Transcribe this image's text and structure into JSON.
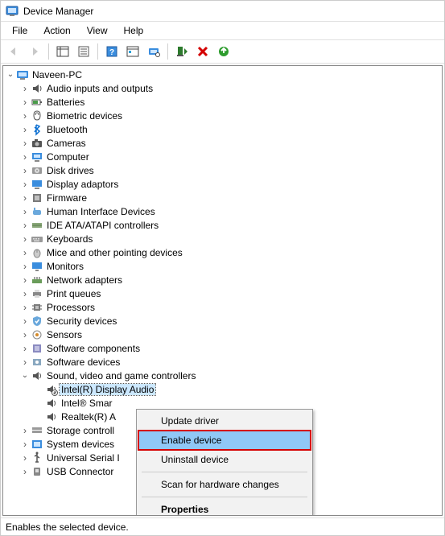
{
  "title": "Device Manager",
  "menu": {
    "file": "File",
    "action": "Action",
    "view": "View",
    "help": "Help"
  },
  "root": "Naveen-PC",
  "cats": [
    {
      "label": "Audio inputs and outputs",
      "icon": "speaker"
    },
    {
      "label": "Batteries",
      "icon": "battery"
    },
    {
      "label": "Biometric devices",
      "icon": "finger"
    },
    {
      "label": "Bluetooth",
      "icon": "bluetooth"
    },
    {
      "label": "Cameras",
      "icon": "camera"
    },
    {
      "label": "Computer",
      "icon": "computer"
    },
    {
      "label": "Disk drives",
      "icon": "disk"
    },
    {
      "label": "Display adaptors",
      "icon": "display"
    },
    {
      "label": "Firmware",
      "icon": "firmware"
    },
    {
      "label": "Human Interface Devices",
      "icon": "hid"
    },
    {
      "label": "IDE ATA/ATAPI controllers",
      "icon": "ide"
    },
    {
      "label": "Keyboards",
      "icon": "keyboard"
    },
    {
      "label": "Mice and other pointing devices",
      "icon": "mouse"
    },
    {
      "label": "Monitors",
      "icon": "monitor"
    },
    {
      "label": "Network adapters",
      "icon": "net"
    },
    {
      "label": "Print queues",
      "icon": "printer"
    },
    {
      "label": "Processors",
      "icon": "cpu"
    },
    {
      "label": "Security devices",
      "icon": "security"
    },
    {
      "label": "Sensors",
      "icon": "sensor"
    },
    {
      "label": "Software components",
      "icon": "swc"
    },
    {
      "label": "Software devices",
      "icon": "swd"
    }
  ],
  "sound": {
    "label": "Sound, video and game controllers",
    "children": [
      {
        "label": "Intel(R) Display Audio",
        "disabled": true,
        "selected": true
      },
      {
        "label": "Intel® Smar",
        "disabled": false
      },
      {
        "label": "Realtek(R) A",
        "disabled": false
      }
    ]
  },
  "cats2": [
    {
      "label": "Storage controll",
      "icon": "storage"
    },
    {
      "label": "System devices",
      "icon": "system"
    },
    {
      "label": "Universal Serial I",
      "icon": "usb"
    },
    {
      "label": "USB Connector",
      "icon": "usbconn"
    }
  ],
  "context": {
    "update": "Update driver",
    "enable": "Enable device",
    "uninstall": "Uninstall device",
    "scan": "Scan for hardware changes",
    "properties": "Properties"
  },
  "status": "Enables the selected device."
}
